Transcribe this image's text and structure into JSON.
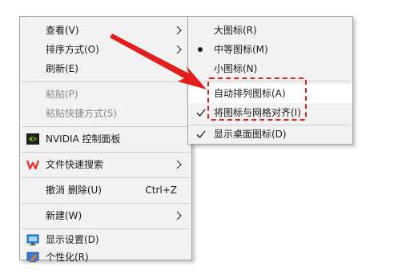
{
  "main_menu": {
    "view": "查看(V)",
    "sort": "排序方式(O)",
    "refresh": "刷新(E)",
    "paste": "粘贴(P)",
    "paste_shortcut": "粘贴快捷方式(S)",
    "nvidia": "NVIDIA 控制面板",
    "file_search": "文件快速搜索",
    "undo_delete": "撤消 删除(U)",
    "undo_shortcut": "Ctrl+Z",
    "new": "新建(W)",
    "display_settings": "显示设置(D)",
    "personalize": "个性化(R)"
  },
  "view_submenu": {
    "large_icons": "大图标(R)",
    "medium_icons": "中等图标(M)",
    "small_icons": "小图标(N)",
    "auto_arrange": "自动排列图标(A)",
    "align_to_grid": "将图标与网格对齐(I)",
    "show_desktop_icons": "显示桌面图标(D)",
    "selected": "medium_icons",
    "checked": [
      "align_to_grid",
      "show_desktop_icons"
    ]
  },
  "colors": {
    "annotation_red": "#e21e1e",
    "menu_bg": "#f2f2f2",
    "nvidia_green": "#76b900",
    "wps_red": "#e8322c"
  }
}
